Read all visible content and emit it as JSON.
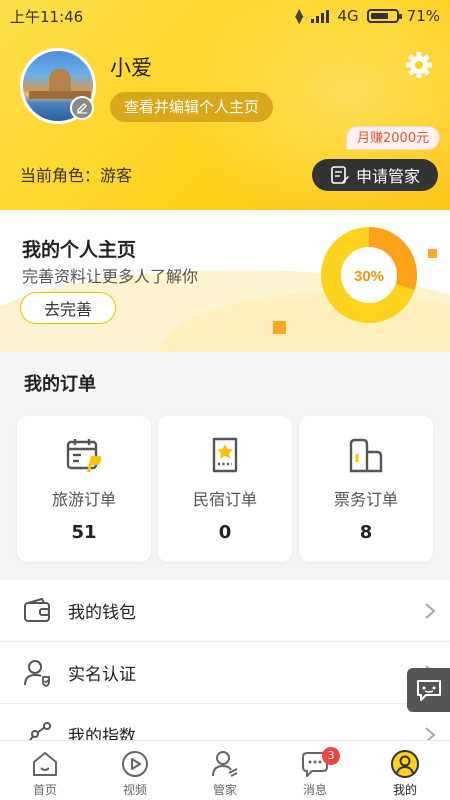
{
  "status_bar": {
    "time": "上午11:46",
    "network": "4G",
    "battery": "71%",
    "battery_level": 0.71
  },
  "profile": {
    "username": "小爱",
    "edit_button": "查看并编辑个人主页",
    "role_label": "当前角色：游客",
    "earn_badge": "月赚2000元",
    "apply_button": "申请管家"
  },
  "homepage_card": {
    "title": "我的个人主页",
    "subtitle": "完善资料让更多人了解你",
    "complete_button": "去完善",
    "progress_text": "30%",
    "progress": 0.3
  },
  "orders": {
    "title": "我的订单",
    "items": [
      {
        "label": "旅游订单",
        "count": "51",
        "icon": "calendar-ticket-icon"
      },
      {
        "label": "民宿订单",
        "count": "0",
        "icon": "star-ticket-icon"
      },
      {
        "label": "票务订单",
        "count": "8",
        "icon": "ticket-stub-icon"
      }
    ]
  },
  "menu": {
    "items": [
      {
        "label": "我的钱包",
        "icon": "wallet-icon"
      },
      {
        "label": "实名认证",
        "icon": "verified-user-icon"
      },
      {
        "label": "我的指数",
        "icon": "index-chart-icon"
      }
    ]
  },
  "bottom_nav": {
    "items": [
      {
        "label": "首页",
        "icon": "home-icon"
      },
      {
        "label": "视频",
        "icon": "video-play-icon"
      },
      {
        "label": "管家",
        "icon": "butler-icon"
      },
      {
        "label": "消息",
        "icon": "message-icon",
        "badge": "3"
      },
      {
        "label": "我的",
        "icon": "profile-icon",
        "active": true
      }
    ]
  },
  "colors": {
    "brand_yellow": "#ffd21f",
    "accent_orange": "#ffa726",
    "badge_red": "#f4433c",
    "dark": "#333333"
  }
}
